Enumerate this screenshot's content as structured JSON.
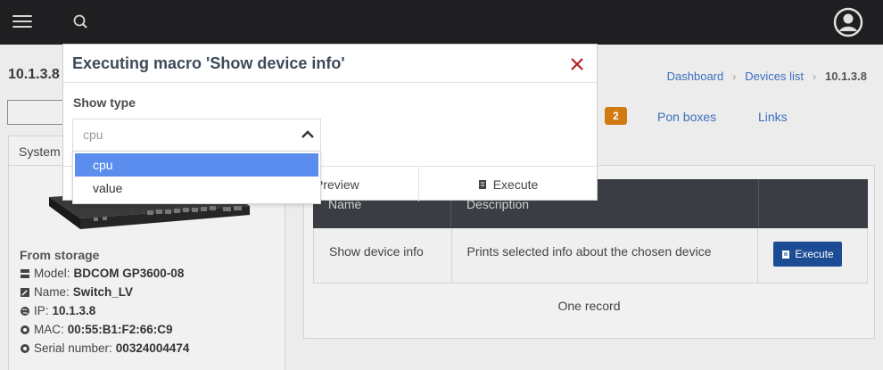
{
  "header": {
    "menu_icon": "hamburger-menu-icon",
    "search_icon": "search-icon",
    "avatar_icon": "user-avatar-icon"
  },
  "page": {
    "title": "10.1.3.8"
  },
  "breadcrumb": {
    "items": [
      "Dashboard",
      "Devices list"
    ],
    "current": "10.1.3.8"
  },
  "tabs": {
    "badge": "2",
    "pon_boxes": "Pon boxes",
    "links": "Links"
  },
  "system_card": {
    "header": "System",
    "storage_title": "From storage",
    "rows": [
      {
        "label": "Model:",
        "value": "BDCOM GP3600-08",
        "icon": "server-icon"
      },
      {
        "label": "Name:",
        "value": "Switch_LV",
        "icon": "edit-icon"
      },
      {
        "label": "IP:",
        "value": "10.1.3.8",
        "icon": "globe-icon"
      },
      {
        "label": "MAC:",
        "value": "00:55:B1:F2:66:C9",
        "icon": "gear-icon"
      },
      {
        "label": "Serial number:",
        "value": "00324004474",
        "icon": "gear-icon"
      }
    ]
  },
  "macros_table": {
    "columns": [
      "Name",
      "Description",
      ""
    ],
    "rows": [
      {
        "name": "Show device info",
        "description": "Prints selected info about the chosen device",
        "action": "Execute"
      }
    ],
    "footer": "One record"
  },
  "modal": {
    "title": "Executing macro 'Show device info'",
    "field_label": "Show type",
    "select_value": "cpu",
    "options": [
      "cpu",
      "value"
    ],
    "preview_label": "Preview",
    "execute_label": "Execute"
  },
  "colors": {
    "topbar": "#1f1f22",
    "accent": "#1c4d94",
    "badge": "#d17a12",
    "selected_option": "#5b8def",
    "close": "#b22222"
  }
}
